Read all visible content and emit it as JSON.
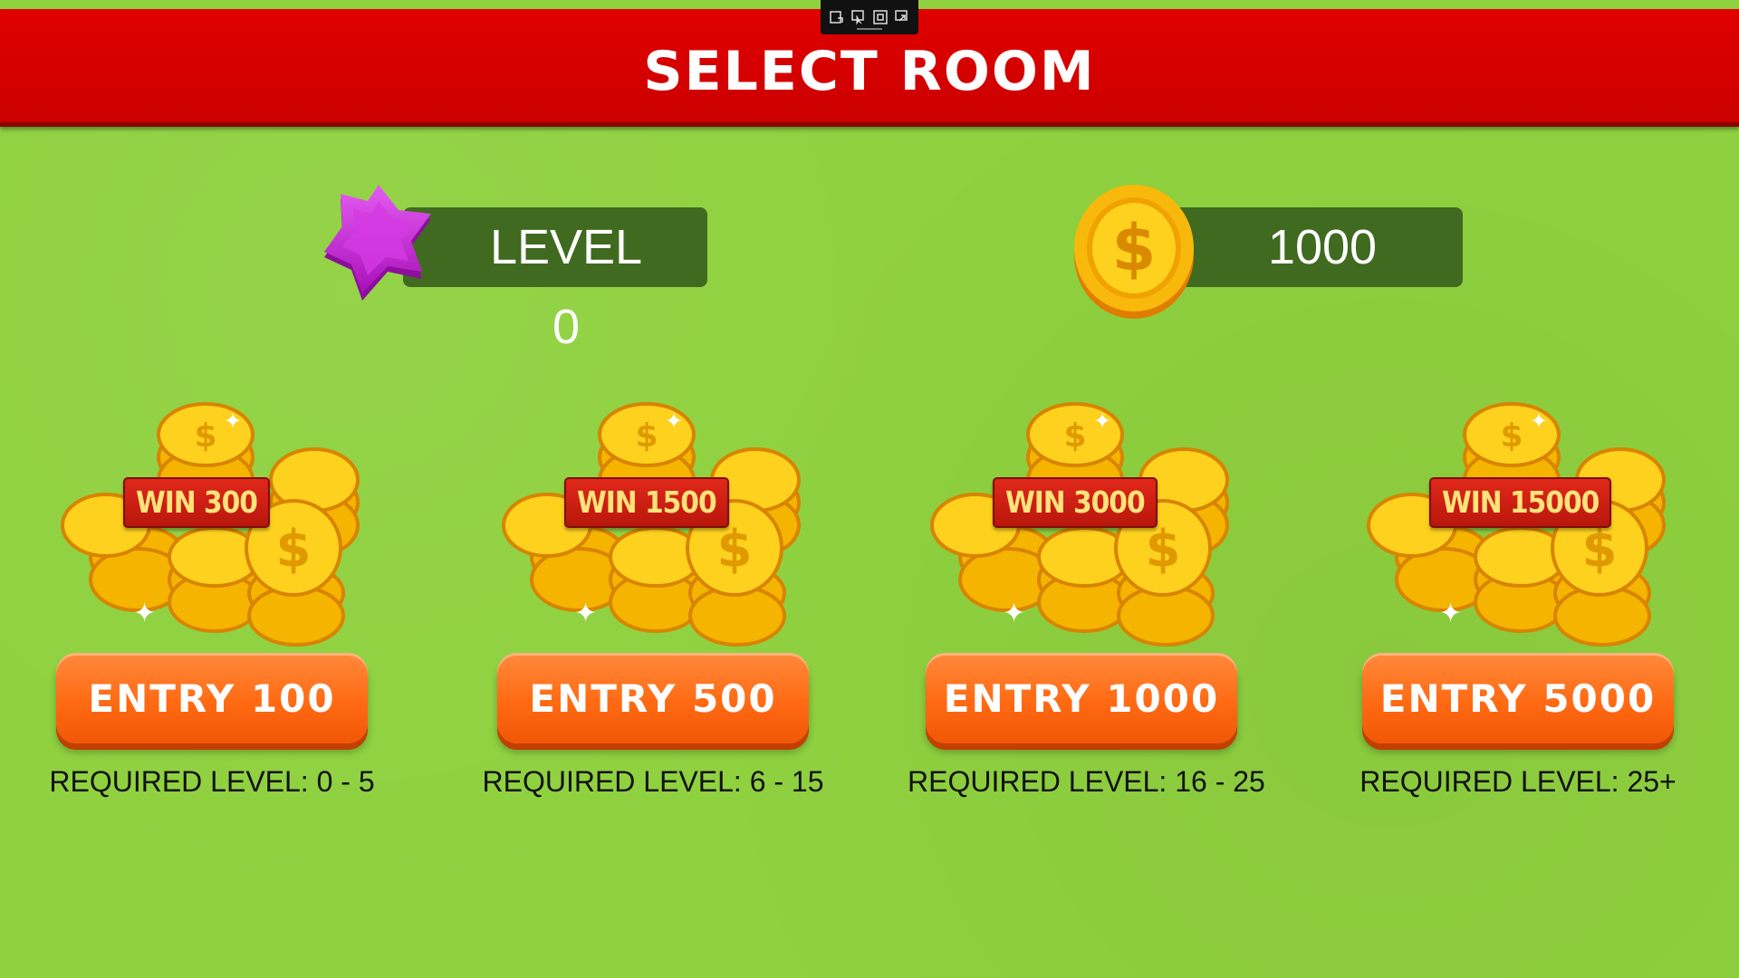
{
  "header": {
    "title": "SELECT ROOM"
  },
  "window_toolbar": {
    "icons": [
      "capture-icon",
      "pointer-icon",
      "frame-icon",
      "exit-icon"
    ]
  },
  "player": {
    "level_label": "LEVEL 0",
    "coins": "1000"
  },
  "rooms": [
    {
      "win": "WIN 300",
      "entry": "ENTRY 100",
      "required": "REQUIRED LEVEL:  0 - 5"
    },
    {
      "win": "WIN 1500",
      "entry": "ENTRY 500",
      "required": "REQUIRED LEVEL:  6 - 15"
    },
    {
      "win": "WIN 3000",
      "entry": "ENTRY 1000",
      "required": "REQUIRED LEVEL:  16 - 25"
    },
    {
      "win": "WIN 15000",
      "entry": "ENTRY 5000",
      "required": "REQUIRED LEVEL:  25+"
    }
  ],
  "colors": {
    "background": "#8fd13f",
    "header": "#d20000",
    "panel": "#3f6a1f",
    "button": "#ff6a13",
    "star": "#d42ee0",
    "coin": "#f5b400",
    "win_tag": "#d0200f"
  }
}
